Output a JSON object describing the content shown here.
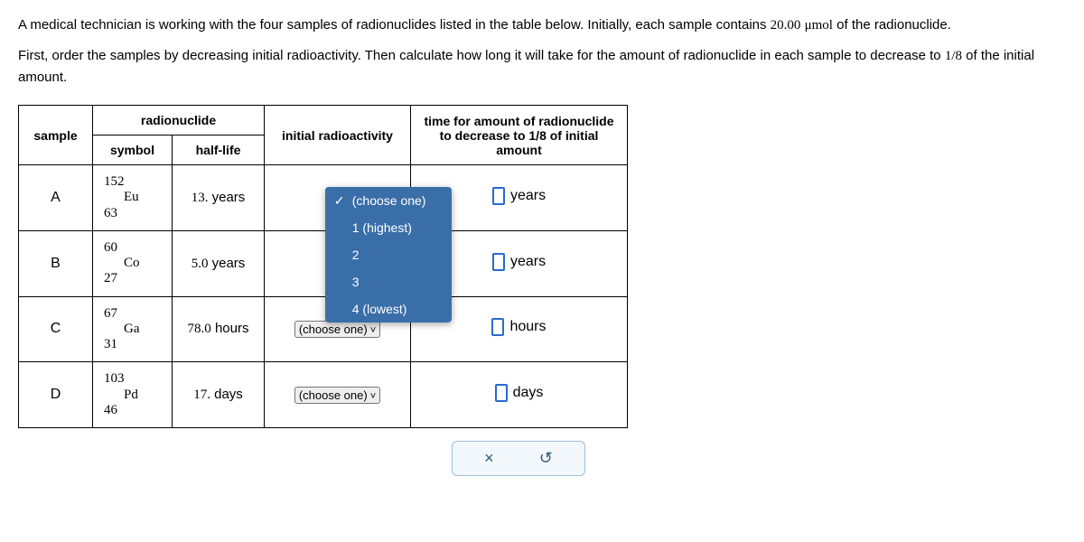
{
  "intro": {
    "line1_pre": "A medical technician is working with the four samples of radionuclides listed in the table below. Initially, each sample contains ",
    "amount_num": "20.00",
    "amount_unit": "μmol",
    "line1_post": " of the radionuclide.",
    "line2_pre": "First, order the samples by decreasing initial radioactivity. Then calculate how long it will take for the amount of radionuclide in each sample to decrease to ",
    "fraction": "1/8",
    "line2_post": " of the initial amount."
  },
  "headers": {
    "sample": "sample",
    "radionuclide": "radionuclide",
    "symbol": "symbol",
    "halflife": "half-life",
    "initial_radio": "initial radioactivity",
    "time_col": "time for amount of radionuclide to decrease to 1/8 of initial amount"
  },
  "dropdown": {
    "placeholder": "(choose one)",
    "opt1": "1 (highest)",
    "opt2": "2",
    "opt3": "3",
    "opt4": "4 (lowest)"
  },
  "rows": [
    {
      "sample": "A",
      "mass": "152",
      "element": "Eu",
      "atomic": "63",
      "hl_num": "13.",
      "hl_unit": "years",
      "time_unit": "years",
      "dropdown_open": true
    },
    {
      "sample": "B",
      "mass": "60",
      "element": "Co",
      "atomic": "27",
      "hl_num": "5.0",
      "hl_unit": "years",
      "time_unit": "years",
      "dropdown_open": false
    },
    {
      "sample": "C",
      "mass": "67",
      "element": "Ga",
      "atomic": "31",
      "hl_num": "78.0",
      "hl_unit": "hours",
      "time_unit": "hours",
      "dropdown_open": false
    },
    {
      "sample": "D",
      "mass": "103",
      "element": "Pd",
      "atomic": "46",
      "hl_num": "17.",
      "hl_unit": "days",
      "time_unit": "days",
      "dropdown_open": false
    }
  ],
  "controls": {
    "clear": "×",
    "reset": "↺"
  }
}
